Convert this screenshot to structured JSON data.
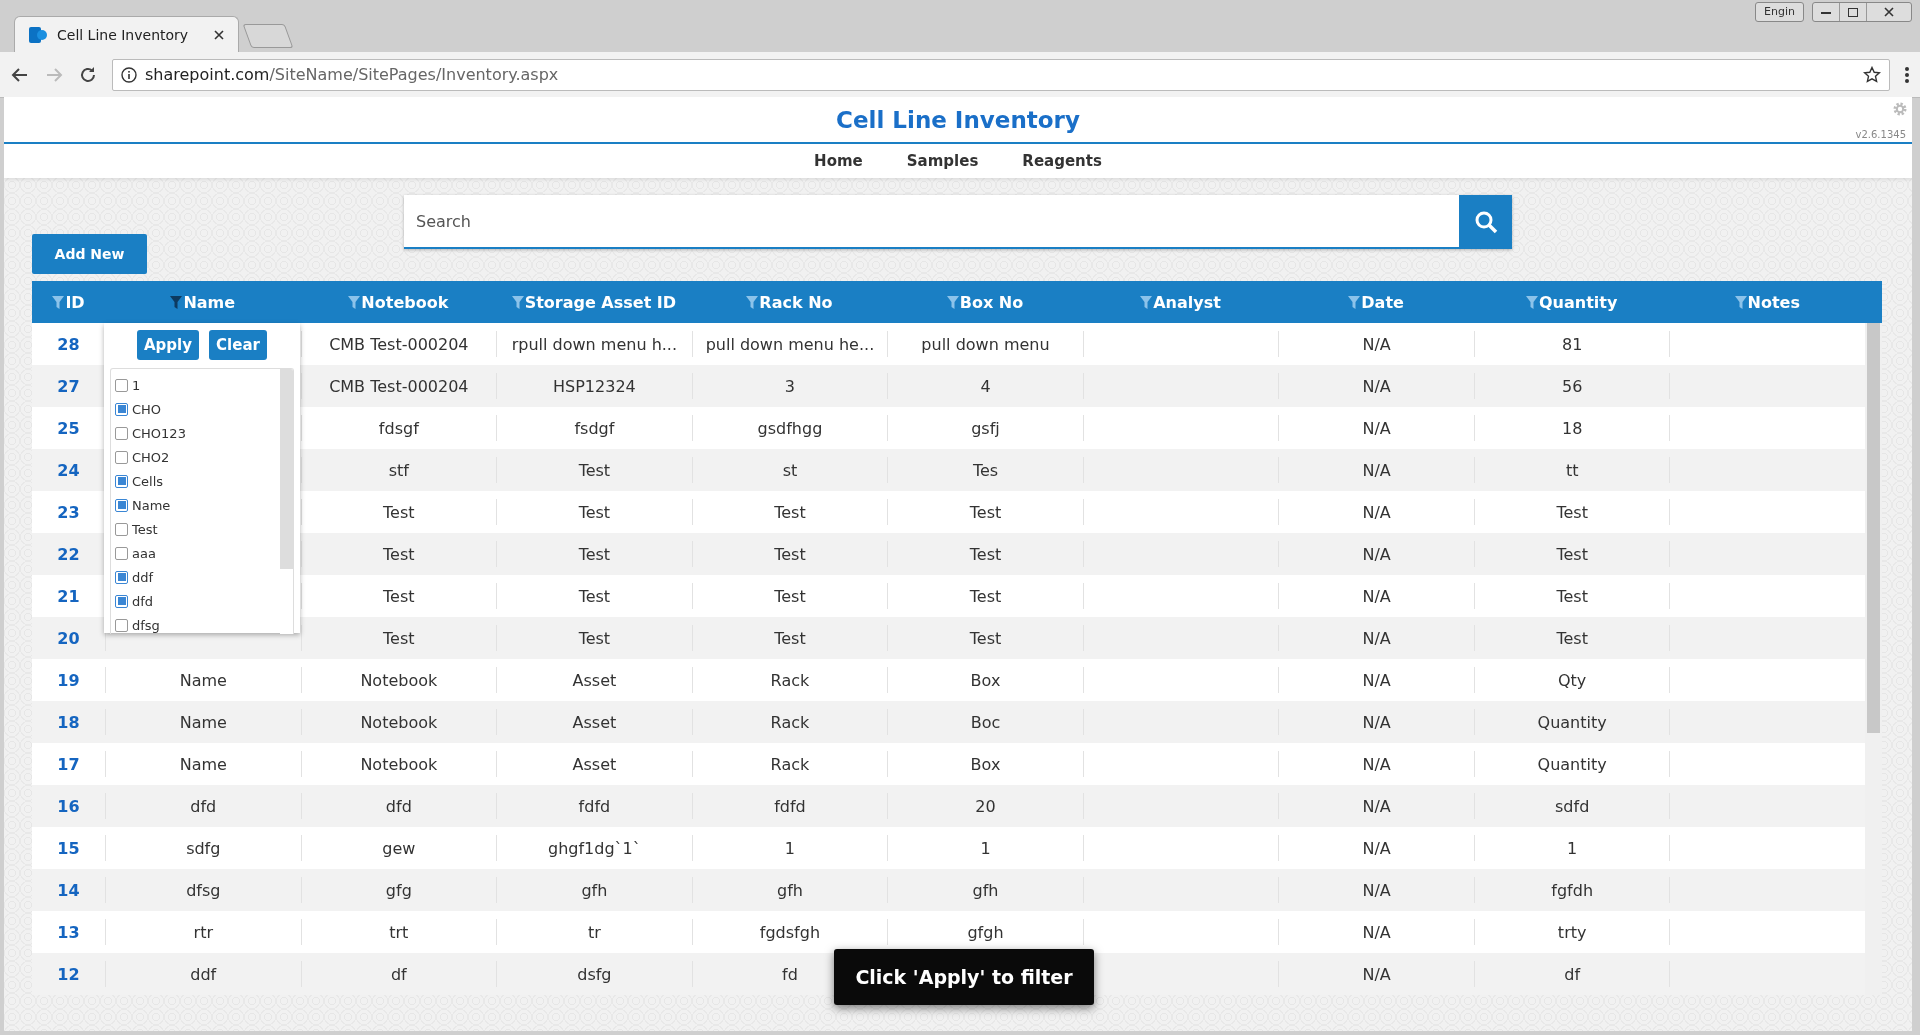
{
  "browser": {
    "tab_title": "Cell Line Inventory",
    "url_host": "sharepoint.com",
    "url_path": "/SiteName/SitePages/Inventory.aspx",
    "lang_button": "Engin"
  },
  "app": {
    "title": "Cell Line Inventory",
    "version": "v2.6.1345",
    "nav": [
      "Home",
      "Samples",
      "Reagents"
    ]
  },
  "search": {
    "placeholder": "Search"
  },
  "add_button": "Add New",
  "table": {
    "columns": [
      {
        "label": "ID",
        "filter_active": false
      },
      {
        "label": "Name",
        "filter_active": true
      },
      {
        "label": "Notebook",
        "filter_active": false
      },
      {
        "label": "Storage Asset ID",
        "filter_active": false
      },
      {
        "label": "Rack No",
        "filter_active": false
      },
      {
        "label": "Box No",
        "filter_active": false
      },
      {
        "label": "Analyst",
        "filter_active": false
      },
      {
        "label": "Date",
        "filter_active": false
      },
      {
        "label": "Quantity",
        "filter_active": false
      },
      {
        "label": "Notes",
        "filter_active": false
      }
    ],
    "rows": [
      {
        "id": "28",
        "notebook": "CMB Test-000204",
        "storage_asset_id": "rpull down menu h...",
        "rack_no": "pull down menu he...",
        "box_no": "pull down menu",
        "date": "N/A",
        "quantity": "81"
      },
      {
        "id": "27",
        "notebook": "CMB Test-000204",
        "storage_asset_id": "HSP12324",
        "rack_no": "3",
        "box_no": "4",
        "date": "N/A",
        "quantity": "56"
      },
      {
        "id": "25",
        "notebook": "fdsgf",
        "storage_asset_id": "fsdgf",
        "rack_no": "gsdfhgg",
        "box_no": "gsfj",
        "date": "N/A",
        "quantity": "18"
      },
      {
        "id": "24",
        "notebook": "stf",
        "storage_asset_id": "Test",
        "rack_no": "st",
        "box_no": "Tes",
        "date": "N/A",
        "quantity": "tt"
      },
      {
        "id": "23",
        "notebook": "Test",
        "storage_asset_id": "Test",
        "rack_no": "Test",
        "box_no": "Test",
        "date": "N/A",
        "quantity": "Test"
      },
      {
        "id": "22",
        "notebook": "Test",
        "storage_asset_id": "Test",
        "rack_no": "Test",
        "box_no": "Test",
        "date": "N/A",
        "quantity": "Test"
      },
      {
        "id": "21",
        "notebook": "Test",
        "storage_asset_id": "Test",
        "rack_no": "Test",
        "box_no": "Test",
        "date": "N/A",
        "quantity": "Test"
      },
      {
        "id": "20",
        "notebook": "Test",
        "storage_asset_id": "Test",
        "rack_no": "Test",
        "box_no": "Test",
        "date": "N/A",
        "quantity": "Test"
      },
      {
        "id": "19",
        "name": "Name",
        "notebook": "Notebook",
        "storage_asset_id": "Asset",
        "rack_no": "Rack",
        "box_no": "Box",
        "date": "N/A",
        "quantity": "Qty"
      },
      {
        "id": "18",
        "name": "Name",
        "notebook": "Notebook",
        "storage_asset_id": "Asset",
        "rack_no": "Rack",
        "box_no": "Boc",
        "date": "N/A",
        "quantity": "Quantity"
      },
      {
        "id": "17",
        "name": "Name",
        "notebook": "Notebook",
        "storage_asset_id": "Asset",
        "rack_no": "Rack",
        "box_no": "Box",
        "date": "N/A",
        "quantity": "Quantity"
      },
      {
        "id": "16",
        "name": "dfd",
        "notebook": "dfd",
        "storage_asset_id": "fdfd",
        "rack_no": "fdfd",
        "box_no": "20",
        "date": "N/A",
        "quantity": "sdfd"
      },
      {
        "id": "15",
        "name": "sdfg",
        "notebook": "gew",
        "storage_asset_id": "ghgf1dg`1`",
        "rack_no": "1",
        "box_no": "1",
        "date": "N/A",
        "quantity": "1"
      },
      {
        "id": "14",
        "name": "dfsg",
        "notebook": "gfg",
        "storage_asset_id": "gfh",
        "rack_no": "gfh",
        "box_no": "gfh",
        "date": "N/A",
        "quantity": "fgfdh"
      },
      {
        "id": "13",
        "name": "rtr",
        "notebook": "trt",
        "storage_asset_id": "tr",
        "rack_no": "fgdsfgh",
        "box_no": "gfgh",
        "date": "N/A",
        "quantity": "trty"
      },
      {
        "id": "12",
        "name": "ddf",
        "notebook": "df",
        "storage_asset_id": "dsfg",
        "rack_no": "fd",
        "date": "N/A",
        "quantity": "df"
      }
    ]
  },
  "filter_popup": {
    "apply": "Apply",
    "clear": "Clear",
    "options": [
      {
        "label": "1",
        "checked": false
      },
      {
        "label": "CHO",
        "checked": true
      },
      {
        "label": "CHO123",
        "checked": false
      },
      {
        "label": "CHO2",
        "checked": false
      },
      {
        "label": "Cells",
        "checked": true
      },
      {
        "label": "Name",
        "checked": true
      },
      {
        "label": "Test",
        "checked": false
      },
      {
        "label": "aaa",
        "checked": false
      },
      {
        "label": "ddf",
        "checked": true
      },
      {
        "label": "dfd",
        "checked": true
      },
      {
        "label": "dfsg",
        "checked": false
      }
    ]
  },
  "toast": "Click 'Apply' to filter"
}
